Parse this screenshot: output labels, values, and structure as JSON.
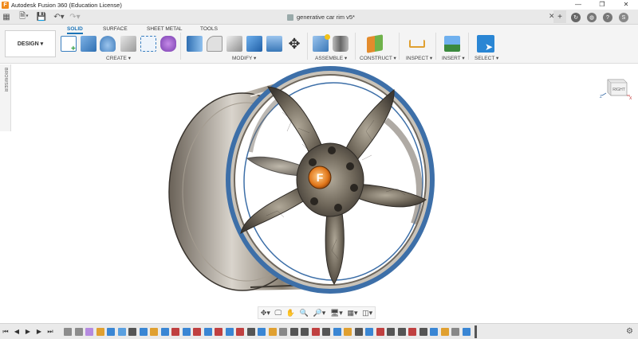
{
  "window": {
    "title": "Autodesk Fusion 360 (Education License)",
    "app_icon": "F",
    "controls": [
      "minimize-icon",
      "restore-icon",
      "close-icon"
    ]
  },
  "quickbar": {
    "icons": [
      "app-grid-icon",
      "file-menu-icon",
      "save-icon",
      "undo-icon",
      "redo-icon"
    ],
    "document_tab": "generative car rim v5*",
    "right_icons": [
      "new-tab-icon",
      "job-status-icon",
      "notifications-icon",
      "help-icon",
      "account-icon"
    ],
    "account_initial": "S"
  },
  "ribbon": {
    "workspace": "DESIGN ▾",
    "tabs": [
      {
        "label": "SOLID",
        "active": true
      },
      {
        "label": "SURFACE",
        "active": false
      },
      {
        "label": "SHEET METAL",
        "active": false
      },
      {
        "label": "TOOLS",
        "active": false
      }
    ],
    "groups": [
      {
        "label": "CREATE ▾"
      },
      {
        "label": "MODIFY ▾"
      },
      {
        "label": "ASSEMBLE ▾"
      },
      {
        "label": "CONSTRUCT ▾"
      },
      {
        "label": "INSPECT ▾"
      },
      {
        "label": "INSERT ▾"
      },
      {
        "label": "SELECT ▾"
      }
    ]
  },
  "browser": {
    "label": "BROWSER"
  },
  "viewcube": {
    "face": "RIGHT",
    "axis_z": "Z",
    "axis_x": "X"
  },
  "model": {
    "center_logo": "F"
  },
  "colors": {
    "accent": "#1b74b8",
    "rim_lip": "#3d6fa8",
    "logo": "#f08a1c",
    "metal": "#8a8070"
  }
}
